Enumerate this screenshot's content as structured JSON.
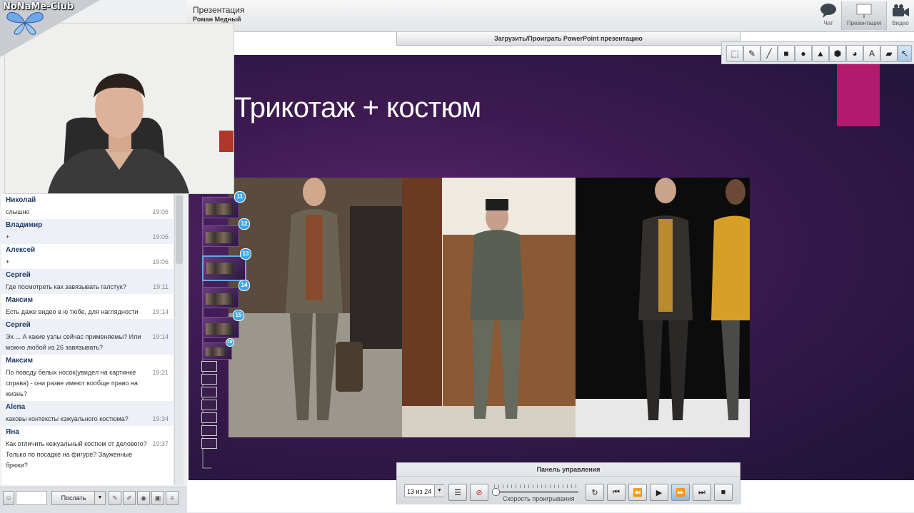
{
  "logo": {
    "text": "NoNaMe-Club"
  },
  "header": {
    "title": "Презентация",
    "presenter": "Роман Медный",
    "tabs": [
      {
        "label": "Чат",
        "icon": "chat-bubble-icon"
      },
      {
        "label": "Презентация",
        "icon": "presentation-board-icon",
        "active": true
      },
      {
        "label": "Видео",
        "icon": "video-camera-icon"
      }
    ]
  },
  "presentation": {
    "upload_label": "Загрузить/Проиграть PowerPoint презентацию",
    "slide_title": "Трикотаж + костюм",
    "accent_color": "#b21a6e"
  },
  "drawing_tools": [
    "select-rect-icon",
    "pencil-icon",
    "line-icon",
    "square-icon",
    "circle-icon",
    "triangle-icon",
    "hexagon-icon",
    "color-picker-icon",
    "text-icon",
    "eraser-icon",
    "pointer-icon"
  ],
  "thumbnails": [
    {
      "number": "11"
    },
    {
      "number": "12"
    },
    {
      "number": "13",
      "selected": true
    },
    {
      "number": "14"
    },
    {
      "number": "15"
    },
    {
      "number": "16"
    }
  ],
  "chat": {
    "messages": [
      {
        "name": "Николай",
        "text": "слышно",
        "time": "19:06"
      },
      {
        "name": "Владимир",
        "text": "+",
        "time": "19:06"
      },
      {
        "name": "Алексей",
        "text": "+",
        "time": "19:06"
      },
      {
        "name": "Сергей",
        "text": "Где посмотреть как завязывать галстук?",
        "time": "19:11"
      },
      {
        "name": "Максим",
        "text": "Есть даже видео в ю тюбе, для наглядности",
        "time": "19:14"
      },
      {
        "name": "Сергей",
        "text": "Эх ... А какие узлы сейчас применяемы? Или можно любой из 26 завязывать?",
        "time": "19:14"
      },
      {
        "name": "Максим",
        "text": "По поводу белых носок(увидел на картинке справа) - они разве имеют вообще право на жизнь?",
        "time": "19:21"
      },
      {
        "name": "Alena",
        "text": "каковы контексты кэжуального костюма?",
        "time": "19:34"
      },
      {
        "name": "Яна",
        "text": "Как отличить кежуальный костюм от делового? Только по посадке на фигуре? Зауженные брюки?",
        "time": "19:37"
      }
    ],
    "send_label": "Послать"
  },
  "control_panel": {
    "title": "Панель управления",
    "slide_counter": "13 из 24",
    "speed_label": "Скорость проигрывания",
    "playback_speed": 0.0
  }
}
